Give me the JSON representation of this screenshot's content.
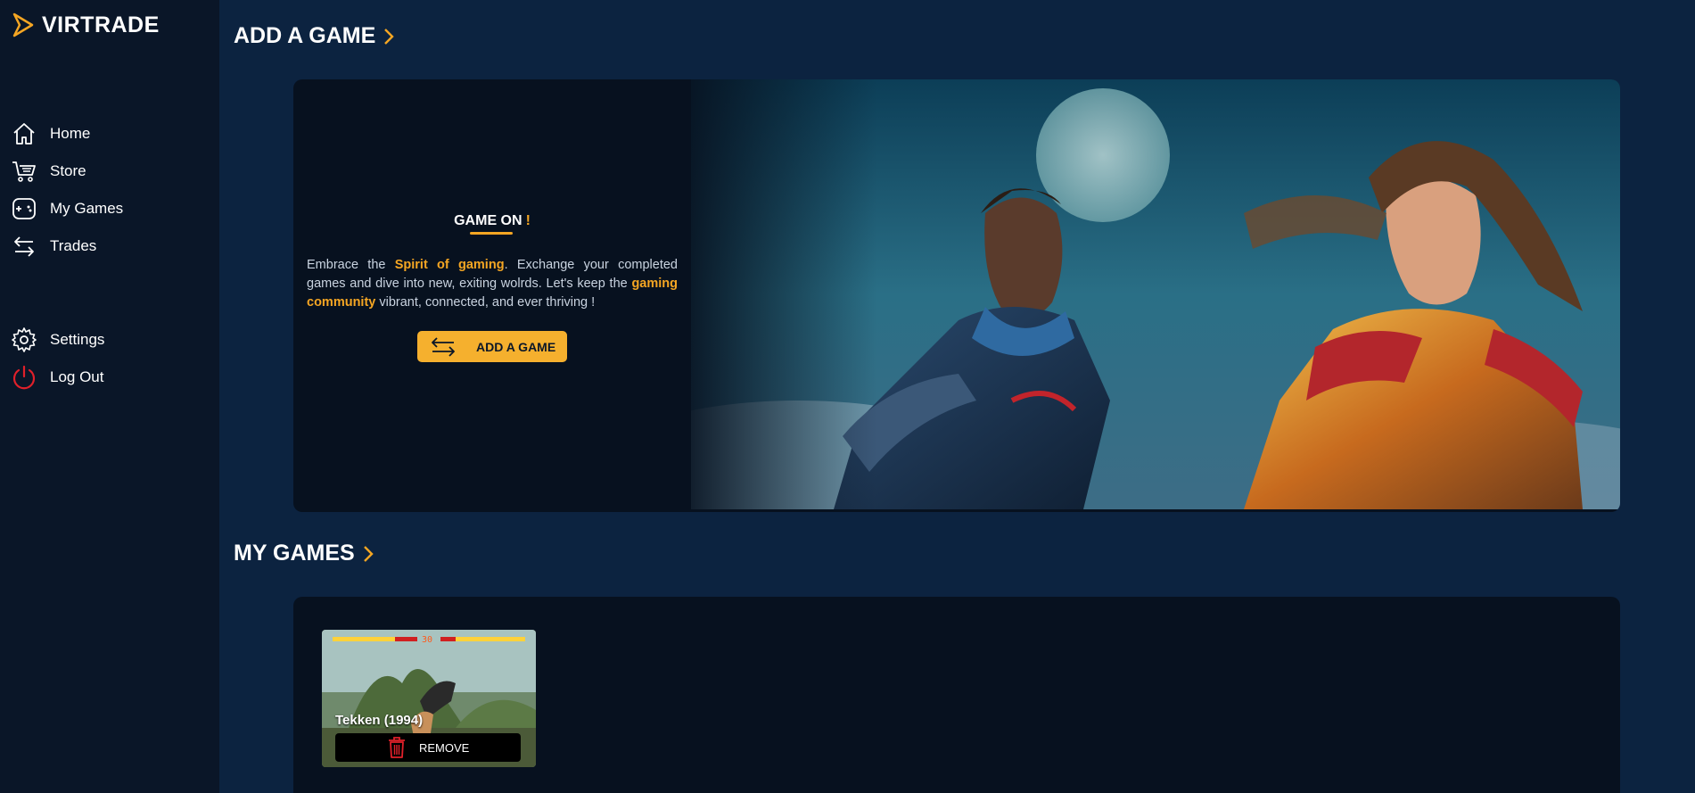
{
  "brand": {
    "name": "VIRTRADE",
    "accent": "#f5a623"
  },
  "nav": {
    "home": "Home",
    "store": "Store",
    "my_games": "My Games",
    "trades": "Trades",
    "settings": "Settings",
    "logout": "Log Out"
  },
  "sections": {
    "add_game_title": "ADD A GAME",
    "my_games_title": "MY GAMES"
  },
  "hero": {
    "title": "GAME ON",
    "title_mark": "!",
    "body_1": "Embrace the ",
    "highlight_1": "Spirit of gaming",
    "body_2": ". Exchange your completed games and dive into new, exiting wolrds. Let's keep the ",
    "highlight_2": "gaming community",
    "body_3": " vibrant, connected, and ever thriving !",
    "button_label": "ADD A GAME"
  },
  "games": [
    {
      "title": "Tekken (1994)",
      "action_label": "REMOVE"
    }
  ]
}
